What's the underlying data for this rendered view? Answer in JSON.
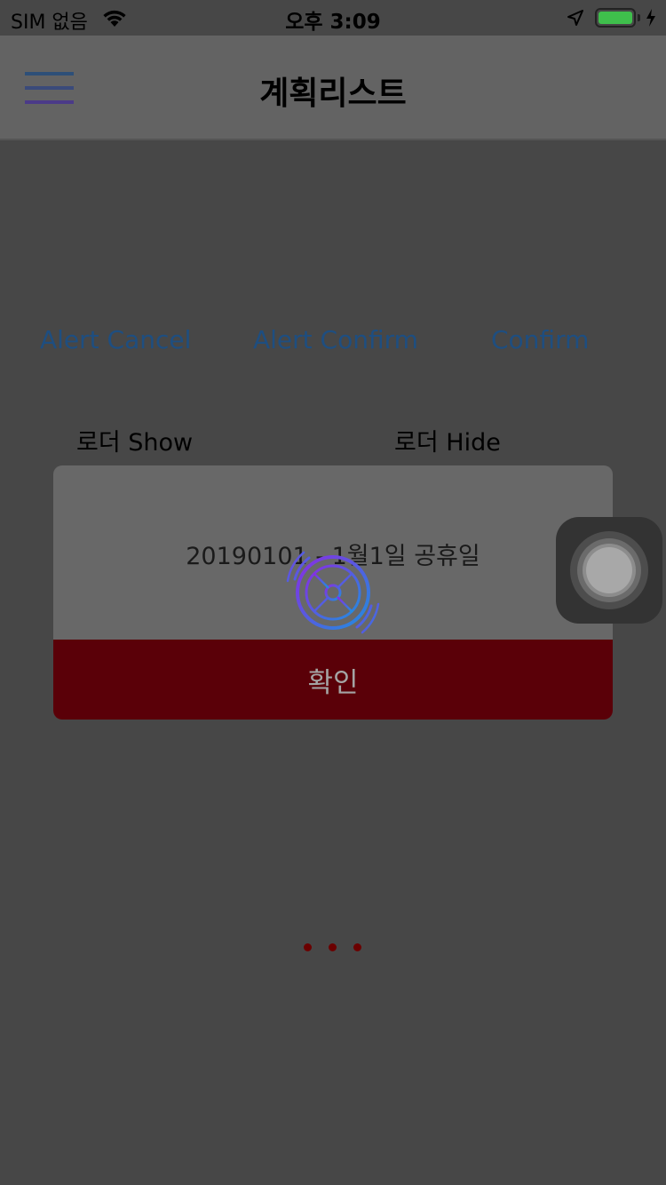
{
  "status_bar": {
    "carrier": "SIM 없음",
    "time": "오후 3:09",
    "icons": [
      "wifi-icon",
      "location-arrow-icon",
      "battery-icon",
      "charging-bolt-icon"
    ]
  },
  "header": {
    "title": "계획리스트",
    "menu_icon": "hamburger-menu-icon"
  },
  "actions": {
    "alert_cancel": "Alert Cancel",
    "alert_confirm": "Alert Confirm",
    "confirm": "Confirm",
    "loader_show": "로더 Show",
    "loader_hide": "로더 Hide"
  },
  "alert": {
    "message": "20190101 - 1월1일 공휴일",
    "confirm_label": "확인"
  },
  "colors": {
    "overlay_bg": "#474747",
    "nav_bg": "#636363",
    "link_text": "#1e4e80",
    "alert_button_bg": "#5a0008",
    "page_dot": "#6b0000"
  },
  "overlays": {
    "loading_spinner": "spinner-wheel-icon",
    "assistive_touch": "assistive-touch-icon"
  },
  "pager": {
    "dot_count": 3
  }
}
